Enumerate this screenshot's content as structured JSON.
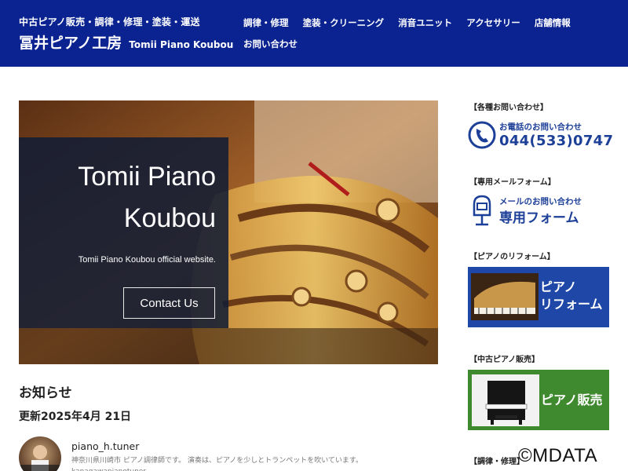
{
  "header": {
    "tagline": "中古ピアノ販売・調律・修理・塗装・運送",
    "site_name": "冨井ピアノ工房",
    "site_sub": "Tomii Piano Koubou",
    "nav": [
      {
        "label": "調律・修理"
      },
      {
        "label": "塗装・クリーニング"
      },
      {
        "label": "消音ユニット"
      },
      {
        "label": "アクセサリー"
      },
      {
        "label": "店舗情報"
      },
      {
        "label": "お問い合わせ"
      }
    ],
    "bg_color": "#0a2391"
  },
  "hero": {
    "title_line1": "Tomii Piano",
    "title_line2": "Koubou",
    "description": "Tomii Piano Koubou official website.",
    "button_label": "Contact Us"
  },
  "news": {
    "title": "お知らせ",
    "updated": "更新2025年4月 21日",
    "author": "piano_h.tuner",
    "bio": "神奈川県川崎市 ピアノ調律師です。 演奏は、ピアノを少しとトランペットを吹いています。 kanagawapianotuner"
  },
  "sidebar": {
    "contact_heading": "【各種お問い合わせ】",
    "phone_label": "お電話のお問い合わせ",
    "phone_number": "044(533)0747",
    "mailform_heading": "【専用メールフォーム】",
    "mail_label": "メールのお問い合わせ",
    "mail_form": "専用フォーム",
    "reform_heading": "【ピアノのリフォーム】",
    "reform_banner_line1": "ピアノ",
    "reform_banner_line2": "リフォーム",
    "used_heading": "【中古ピアノ販売】",
    "used_banner": "ピアノ販売",
    "tuning_heading": "【調律・修理】"
  },
  "watermark": "©MDATA",
  "colors": {
    "accent_blue": "#1c3f97",
    "reform_banner": "#1e47a8",
    "used_banner": "#3f8a2e"
  }
}
